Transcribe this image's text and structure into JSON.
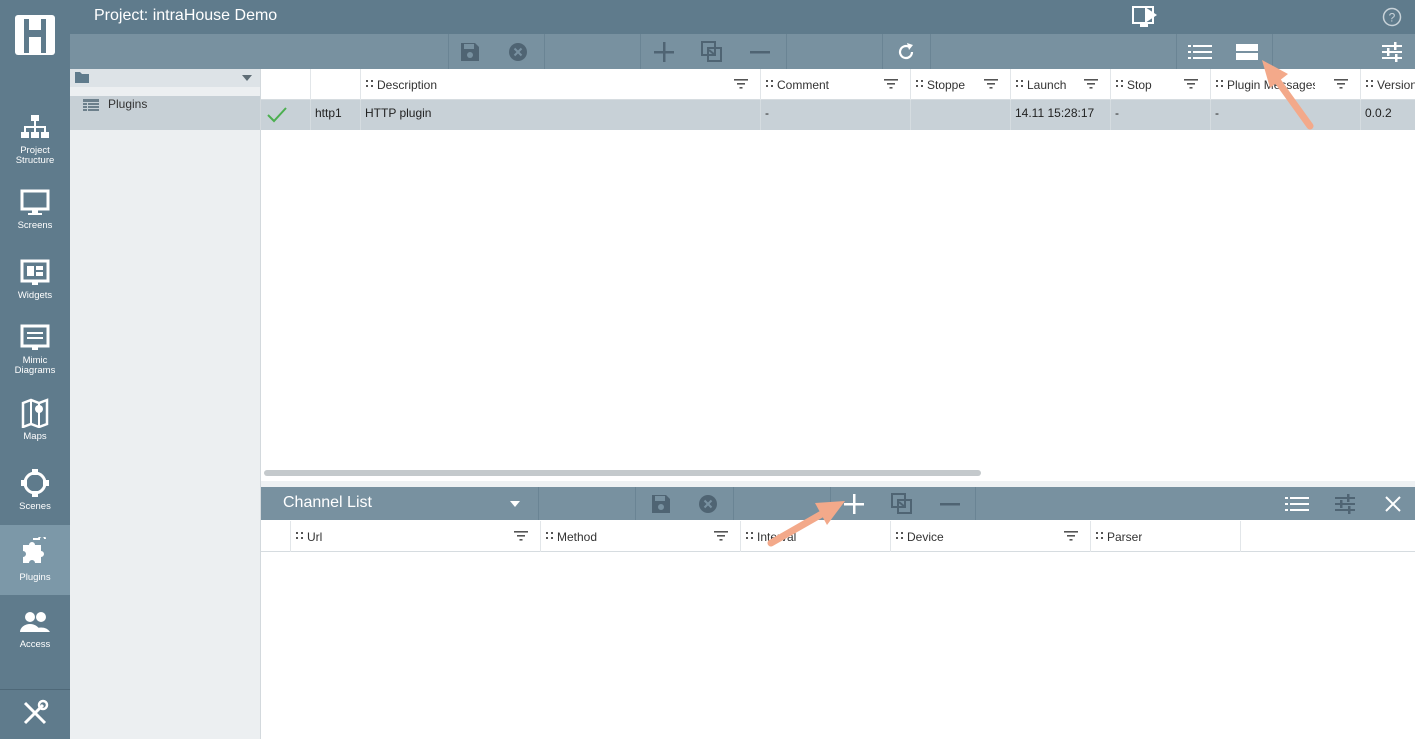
{
  "app": {
    "title": "Project: intraHouse Demo"
  },
  "nav": {
    "items": [
      {
        "label": "Project Structure",
        "icon": "hierarchy-icon"
      },
      {
        "label": "Screens",
        "icon": "monitor-icon"
      },
      {
        "label": "Widgets",
        "icon": "widgets-icon"
      },
      {
        "label": "Mimic Diagrams",
        "icon": "mimic-diagram-icon"
      },
      {
        "label": "Maps",
        "icon": "map-icon"
      },
      {
        "label": "Scenes",
        "icon": "scenes-icon"
      },
      {
        "label": "Plugins",
        "icon": "puzzle-icon",
        "active": true
      },
      {
        "label": "Access",
        "icon": "users-icon"
      }
    ],
    "bottom_icon": "tools-icon"
  },
  "tree": {
    "items": [
      {
        "label": "Plugins",
        "icon": "table-icon"
      }
    ]
  },
  "grid": {
    "columns": [
      "",
      "",
      "Description",
      "Comment",
      "Stoppe",
      "Launch",
      "Stop",
      "Plugin Messages",
      "Version"
    ],
    "rows": [
      {
        "status": "ok-check",
        "id": "http1",
        "description": "HTTP plugin",
        "comment": "-",
        "stopped": "",
        "launch": "14.11 15:28:17",
        "stop": "-",
        "messages": "-",
        "version": "0.0.2"
      }
    ]
  },
  "channel_panel": {
    "title": "Channel List",
    "columns": [
      "Url",
      "Method",
      "Interval",
      "Device",
      "Parser"
    ]
  },
  "colors": {
    "sidebar": "#5f7b8c",
    "toolbar": "#7891a0",
    "selected_row": "#c8d1d7",
    "annotation_arrow": "#f3a98a",
    "check": "#4caf50"
  }
}
